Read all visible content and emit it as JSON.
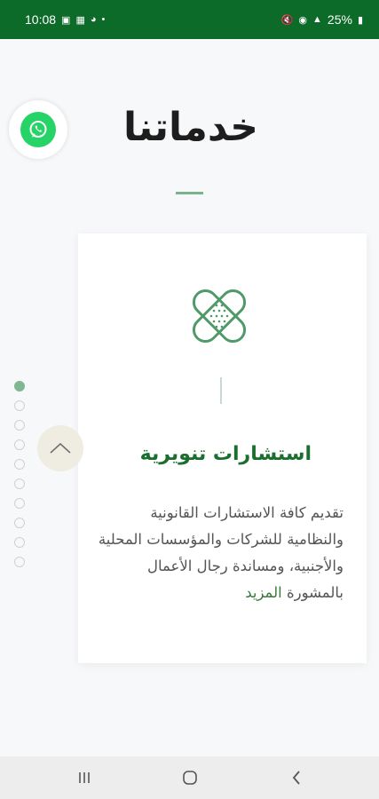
{
  "status_bar": {
    "time": "10:08",
    "battery": "25%",
    "bg_color": "#0d6b2a"
  },
  "floating": {
    "whatsapp_icon": "whatsapp-icon",
    "whatsapp_color": "#25d366",
    "scroll_up_icon": "chevron-up-icon"
  },
  "page": {
    "title": "خدماتنا"
  },
  "service_card": {
    "icon": "bandage-icon",
    "title": "استشارات تنويرية",
    "description": "تقديم كافة الاستشارات القانونية والنظامية للشركات والمؤسسات المحلية والأجنبية، ومساندة رجال الأعمال بالمشورة",
    "more_label": "المزيد",
    "accent_color": "#1a6e2e"
  },
  "pagination": {
    "total": 10,
    "active_index": 0
  },
  "nav": {
    "recents_icon": "recents-icon",
    "home_icon": "home-icon",
    "back_icon": "back-icon"
  }
}
